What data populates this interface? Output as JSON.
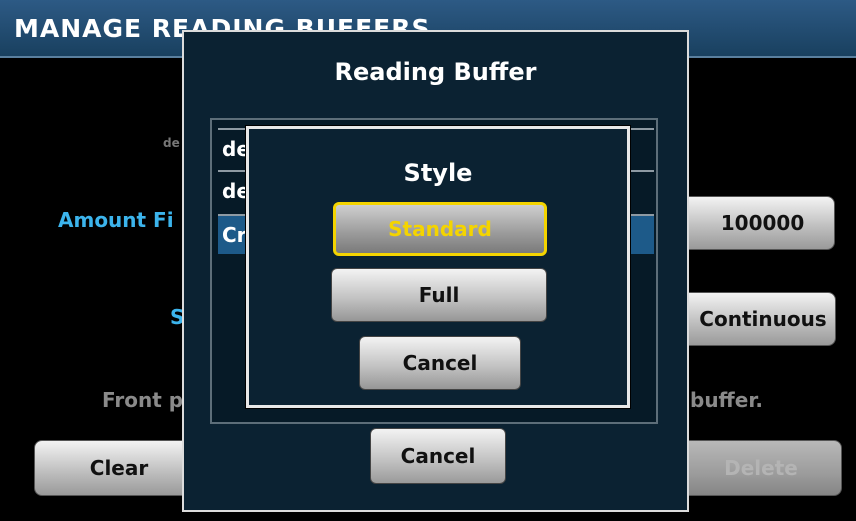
{
  "screen": {
    "title": "MANAGE READING BUFFERS"
  },
  "background": {
    "small_text": "de",
    "amount_label": "Amount Fi",
    "amount_value": "100000",
    "s_label": "S",
    "mode_value": "Continuous",
    "front_text": "Front p",
    "buffer_text": "buffer.",
    "clear_label": "Clear",
    "delete_label": "Delete"
  },
  "reading_buffer_dialog": {
    "title": "Reading Buffer",
    "rows": [
      "de",
      "de",
      "Cr"
    ],
    "cancel_label": "Cancel"
  },
  "style_dialog": {
    "title": "Style",
    "options": [
      "Standard",
      "Full"
    ],
    "selected": "Standard",
    "cancel_label": "Cancel"
  },
  "colors": {
    "title_bar": "#1f4a6f",
    "label_blue": "#3cb4ec",
    "selected_yellow": "#f4d400",
    "row_highlight": "#1d5a89",
    "dialog_bg": "#0b2232"
  }
}
